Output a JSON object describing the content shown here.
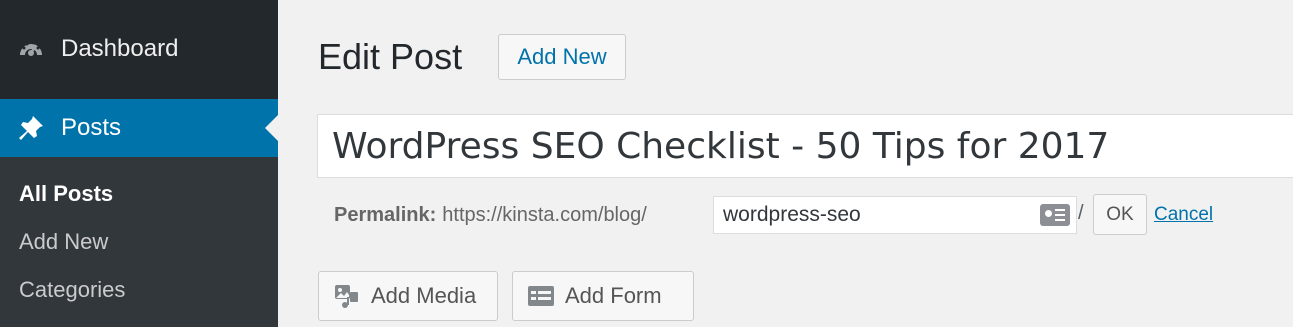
{
  "sidebar": {
    "dashboard_label": "Dashboard",
    "posts_label": "Posts",
    "submenu": {
      "all_posts": "All Posts",
      "add_new": "Add New",
      "categories": "Categories"
    },
    "colors": {
      "background": "#23282d",
      "active": "#0073aa",
      "submenu_bg": "#32373c"
    }
  },
  "header": {
    "title": "Edit Post",
    "add_new_label": "Add New"
  },
  "post": {
    "title_value": "WordPress SEO Checklist - 50 Tips for 2017"
  },
  "permalink": {
    "label": "Permalink:",
    "base_url": "https://kinsta.com/blog/",
    "slug_value": "wordpress-seo",
    "slash": "/",
    "ok_label": "OK",
    "cancel_label": "Cancel"
  },
  "toolbar": {
    "add_media_label": "Add Media",
    "add_form_label": "Add Form"
  },
  "icons": {
    "dashboard": "dashboard-gauge-icon",
    "posts": "pushpin-icon",
    "slug": "id-card-icon",
    "add_media": "media-icon",
    "add_form": "form-icon"
  }
}
